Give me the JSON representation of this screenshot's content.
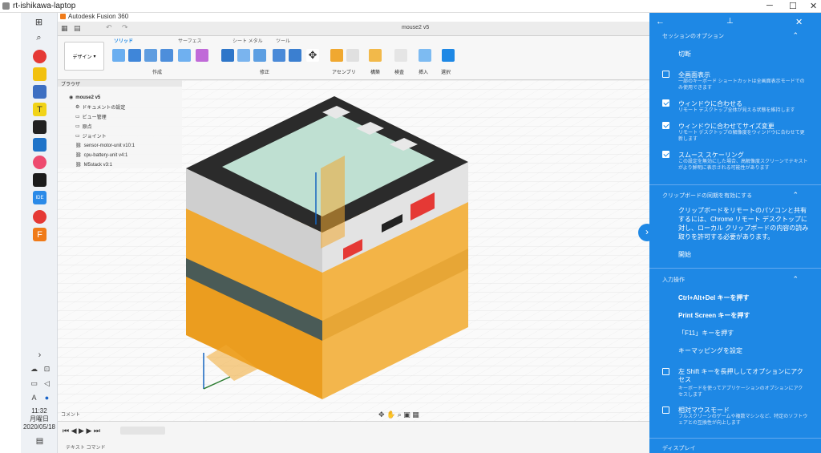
{
  "window": {
    "title": "rt-ishikawa-laptop"
  },
  "fusion": {
    "app_title": "Autodesk Fusion 360",
    "doc_tab": "mouse2 v5",
    "design_button": "デザイン",
    "ribbon_tabs": [
      "ソリッド",
      "サーフェス",
      "シート メタル",
      "ツール"
    ],
    "ribbon_labels": [
      "作成",
      "修正",
      "アセンブリ",
      "構築",
      "検査",
      "挿入",
      "選択"
    ],
    "browser_title": "ブラウザ",
    "browser_items": [
      "mouse2 v5",
      "ドキュメントの設定",
      "ビュー管理",
      "原点",
      "ジョイント",
      "sensor-motor-unit v10:1",
      "cpu-battery-unit v4:1",
      "M5stack v3:1"
    ],
    "comment_label": "コメント",
    "text_command": "テキスト コマンド"
  },
  "taskbar": {
    "time": "11:32",
    "day": "月曜日",
    "date": "2020/05/18"
  },
  "panel": {
    "sections": [
      {
        "title": "セッションのオプション",
        "items": [
          {
            "type": "action",
            "label": "切断"
          },
          {
            "type": "check",
            "checked": false,
            "label": "全画面表示",
            "desc": "一部のキーボード ショートカットは全画面表示モードでのみ使用できます"
          },
          {
            "type": "check",
            "checked": true,
            "label": "ウィンドウに合わせる",
            "desc": "リモート デスクトップ全体が見える状態を維持します"
          },
          {
            "type": "check",
            "checked": true,
            "label": "ウィンドウに合わせてサイズ変更",
            "desc": "リモート デスクトップの解像度をウィンドウに合わせて更新します"
          },
          {
            "type": "check",
            "checked": true,
            "label": "スムース スケーリング",
            "desc": "この設定を無効にした場合、高解像度スクリーンでテキストがより鮮明に表示される可能性があります"
          }
        ]
      },
      {
        "title": "クリップボードの同期を有効にする",
        "body": "クリップボードをリモートのパソコンと共有するには、Chrome リモート デスクトップに対し、ローカル クリップボードの内容の読み取りを許可する必要があります。",
        "action": "開始"
      },
      {
        "title": "入力操作",
        "items": [
          {
            "type": "action",
            "label": "Ctrl+Alt+Del キーを押す"
          },
          {
            "type": "action",
            "label": "Print Screen キーを押す"
          },
          {
            "type": "action",
            "label": "「F11」キーを押す"
          },
          {
            "type": "action",
            "label": "キーマッピングを設定"
          },
          {
            "type": "check",
            "checked": false,
            "label": "左 Shift キーを長押ししてオプションにアクセス",
            "desc": "キーボードを使ってアプリケーションのオプションにアクセスします"
          },
          {
            "type": "check",
            "checked": false,
            "label": "相対マウスモード",
            "desc": "フルスクリーンのゲームや複数マシンなど、特定のソフトウェアとの互換性が向上します"
          }
        ]
      },
      {
        "title": "ディスプレイ"
      }
    ]
  },
  "colors": {
    "accent": "#1e88e5",
    "model_orange": "#f0a830",
    "model_black": "#2b2b2b"
  }
}
